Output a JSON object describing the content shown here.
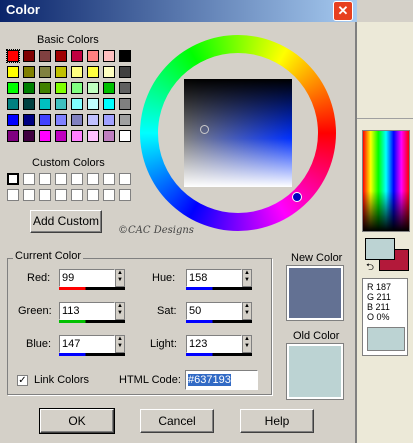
{
  "window": {
    "title": "Color",
    "close_glyph": "✕"
  },
  "basic_colors": {
    "label": "Basic Colors",
    "swatches": [
      "#ff0000",
      "#800000",
      "#804040",
      "#a00000",
      "#c00040",
      "#ff8080",
      "#ffc0c0",
      "#000000",
      "#ffff00",
      "#808000",
      "#808040",
      "#c0c000",
      "#ffff80",
      "#ffff40",
      "#ffffc0",
      "#404040",
      "#00ff00",
      "#008000",
      "#408000",
      "#80ff00",
      "#80ff80",
      "#c0ffc0",
      "#00c000",
      "#606060",
      "#008080",
      "#004040",
      "#00c0c0",
      "#40c0c0",
      "#80ffff",
      "#c0ffff",
      "#00ffff",
      "#808080",
      "#0000ff",
      "#000080",
      "#4040ff",
      "#8080ff",
      "#8080c0",
      "#c0c0ff",
      "#a0a0ff",
      "#a0a0a0",
      "#800080",
      "#400040",
      "#ff00ff",
      "#c000c0",
      "#ff80ff",
      "#ffc0ff",
      "#c080c0",
      "#ffffff"
    ]
  },
  "custom_colors": {
    "label": "Custom Colors",
    "count": 16
  },
  "add_custom_button": "Add Custom",
  "watermark": "©CAC Designs",
  "current_color": {
    "group_label": "Current Color",
    "red": {
      "label": "Red:",
      "value": "99",
      "bar_color": "#ff0000"
    },
    "green": {
      "label": "Green:",
      "value": "113",
      "bar_color": "#00c000"
    },
    "blue": {
      "label": "Blue:",
      "value": "147",
      "bar_color": "#0000ff"
    },
    "hue": {
      "label": "Hue:",
      "value": "158",
      "bar_color": "#0000ff"
    },
    "sat": {
      "label": "Sat:",
      "value": "50",
      "bar_color": "#0000ff"
    },
    "light": {
      "label": "Light:",
      "value": "123",
      "bar_color": "#0000ff"
    },
    "link_colors": {
      "label": "Link Colors",
      "checked": true
    },
    "html_code": {
      "label": "HTML Code:",
      "value": "#637193"
    }
  },
  "new_color": {
    "label": "New Color",
    "color": "#637193"
  },
  "old_color": {
    "label": "Old Color",
    "color": "#bcd3d3"
  },
  "buttons": {
    "ok": "OK",
    "cancel": "Cancel",
    "help": "Help"
  },
  "materials": {
    "fg_color": "#bcd3d3",
    "bg_color": "#b3193a",
    "readout": [
      "R 187",
      "G 211",
      "B 211",
      "O 0%"
    ],
    "sample_color": "#bcd3d3"
  }
}
